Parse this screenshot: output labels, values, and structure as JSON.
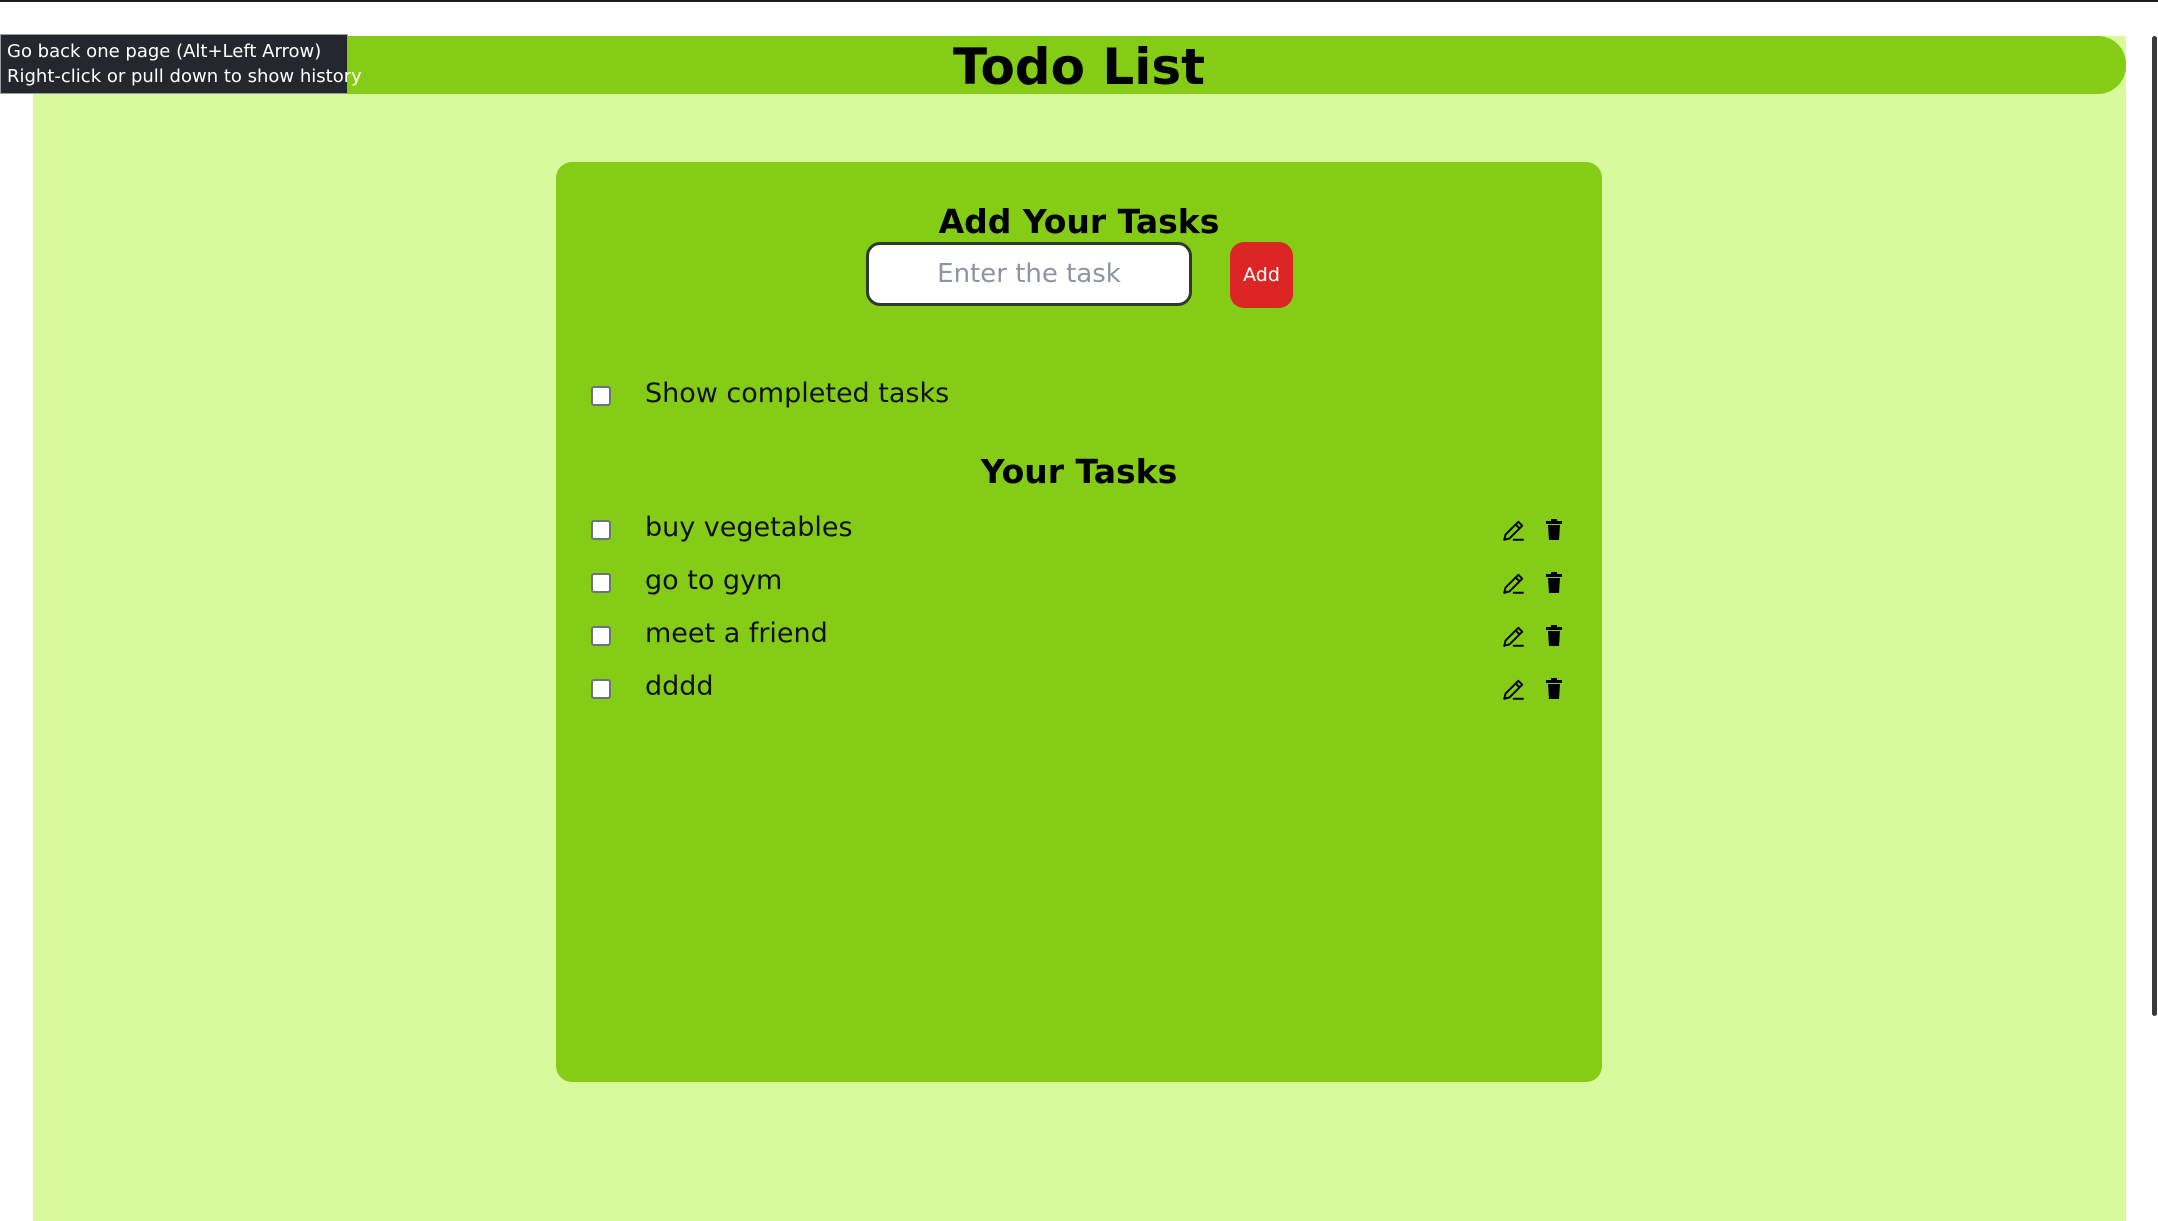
{
  "header": {
    "title": "Todo List"
  },
  "form": {
    "title": "Add Your Tasks",
    "input_placeholder": "Enter the task",
    "input_value": "",
    "add_label": "Add"
  },
  "filter": {
    "show_completed_label": "Show completed tasks",
    "checked": false
  },
  "tasks_section": {
    "title": "Your Tasks"
  },
  "tasks": [
    {
      "label": "buy vegetables",
      "completed": false
    },
    {
      "label": "go to gym",
      "completed": false
    },
    {
      "label": "meet a friend",
      "completed": false
    },
    {
      "label": "dddd",
      "completed": false
    }
  ],
  "icons": {
    "edit": "pencil-icon",
    "delete": "trash-icon"
  },
  "tooltip": {
    "line1": "Go back one page (Alt+Left Arrow)",
    "line2": "Right-click or pull down to show history"
  },
  "colors": {
    "header": "#84cc16",
    "page_background": "#d9f99d",
    "card": "#84cc16",
    "add_button": "#dc2626"
  }
}
